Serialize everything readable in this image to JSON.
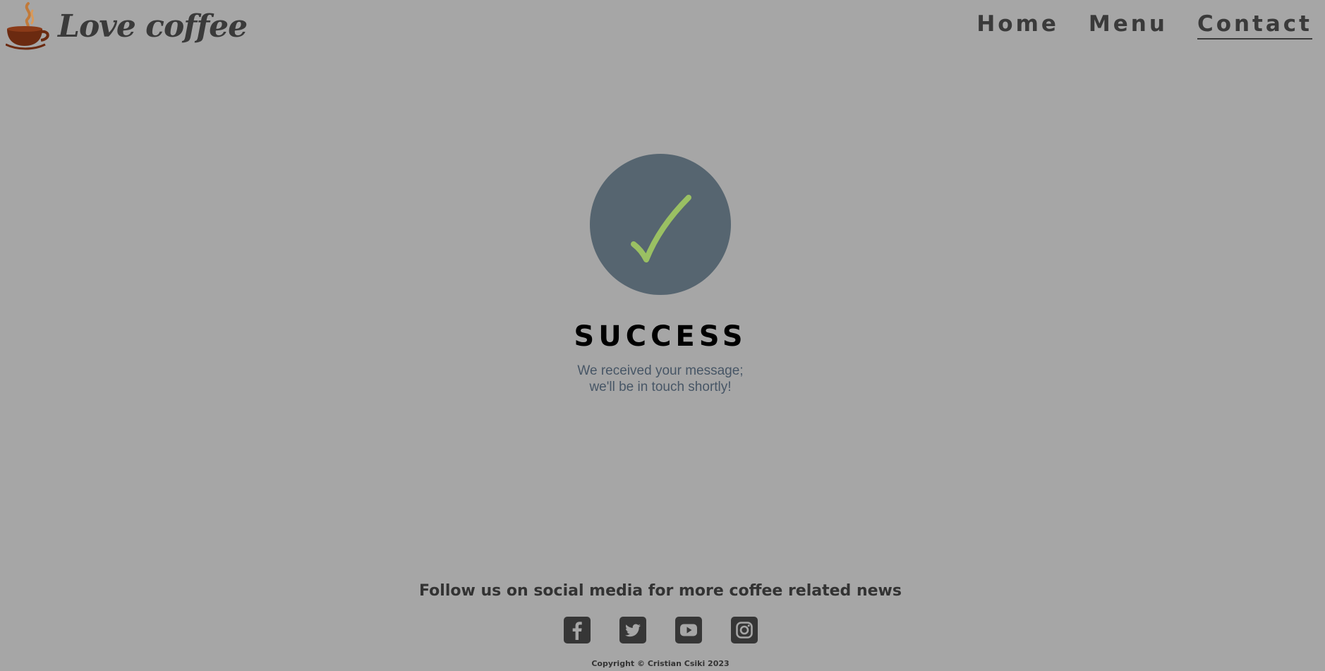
{
  "header": {
    "logo_text": "Love coffee",
    "logo_icon": "coffee-cup-icon",
    "nav": [
      {
        "label": "Home",
        "active": false
      },
      {
        "label": "Menu",
        "active": false
      },
      {
        "label": "Contact",
        "active": true
      }
    ]
  },
  "success": {
    "icon": "checkmark-icon",
    "title": "SUCCESS",
    "message_line1": "We received your message;",
    "message_line2": "we'll be in touch shortly!"
  },
  "footer": {
    "title": "Follow us on social media for more coffee related news",
    "socials": [
      {
        "icon": "facebook-icon"
      },
      {
        "icon": "twitter-icon"
      },
      {
        "icon": "youtube-icon"
      },
      {
        "icon": "instagram-icon"
      }
    ],
    "copyright": "Copyright © Cristian Csiki 2023"
  },
  "colors": {
    "background": "#a6a6a6",
    "circle": "#566570",
    "check": "#9ac063",
    "text_dark": "#3a3a3a",
    "message": "#475666",
    "cup": "#6b2a10"
  }
}
